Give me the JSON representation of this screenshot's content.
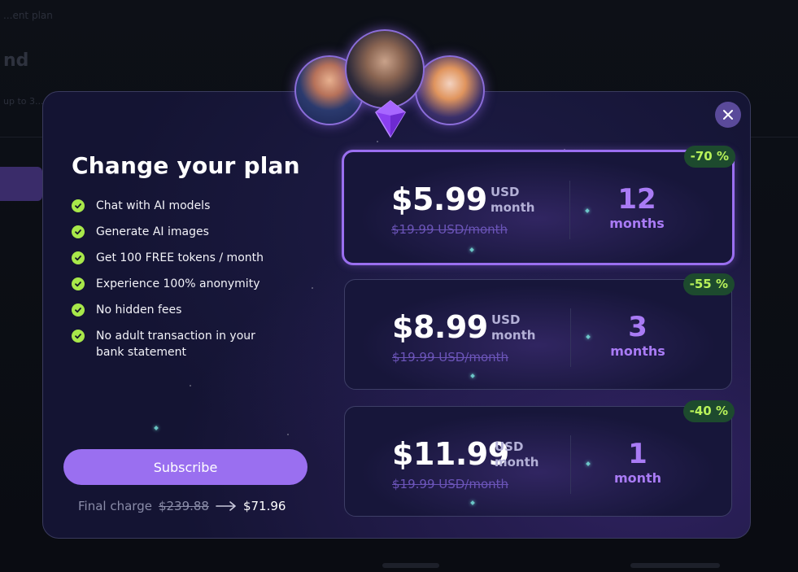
{
  "background": {
    "crumb": "...ent plan",
    "heading": "nd",
    "note": "up to 3..."
  },
  "modal": {
    "title": "Change your plan",
    "features": [
      "Chat with AI models",
      "Generate AI images",
      "Get 100 FREE tokens / month",
      "Experience 100% anonymity",
      "No hidden fees",
      "No adult transaction in your bank statement"
    ],
    "subscribe_label": "Subscribe",
    "final_charge": {
      "label": "Final charge",
      "old": "$239.88",
      "new": "$71.96"
    },
    "plans": [
      {
        "price": "$5.99",
        "currency": "USD",
        "per": "month",
        "old_price": "$19.99 USD/month",
        "duration": "12",
        "duration_unit": "months",
        "discount": "-70 %",
        "selected": true
      },
      {
        "price": "$8.99",
        "currency": "USD",
        "per": "month",
        "old_price": "$19.99 USD/month",
        "duration": "3",
        "duration_unit": "months",
        "discount": "-55 %",
        "selected": false
      },
      {
        "price": "$11.99",
        "currency": "USD",
        "per": "month",
        "old_price": "$19.99 USD/month",
        "duration": "1",
        "duration_unit": "month",
        "discount": "-40 %",
        "selected": false
      }
    ]
  },
  "colors": {
    "accent": "#9a6ff0",
    "check": "#a8e84a",
    "badge_text": "#b8f25a",
    "modal_bg": "#141433"
  },
  "icons": [
    "close-icon",
    "check-icon",
    "gem-icon",
    "arrow-right-icon"
  ]
}
